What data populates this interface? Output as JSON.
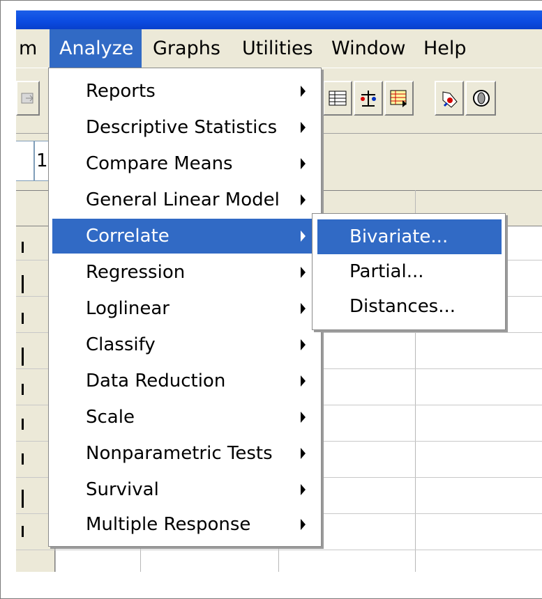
{
  "menubar": {
    "items": [
      {
        "label": "m"
      },
      {
        "label": "Analyze"
      },
      {
        "label": "Graphs"
      },
      {
        "label": "Utilities"
      },
      {
        "label": "Window"
      },
      {
        "label": "Help"
      }
    ]
  },
  "cellbar": {
    "edit_value": "1"
  },
  "analyze_menu": {
    "items": [
      {
        "label": "Reports"
      },
      {
        "label": "Descriptive Statistics"
      },
      {
        "label": "Compare Means"
      },
      {
        "label": "General Linear Model"
      },
      {
        "label": "Correlate"
      },
      {
        "label": "Regression"
      },
      {
        "label": "Loglinear"
      },
      {
        "label": "Classify"
      },
      {
        "label": "Data Reduction"
      },
      {
        "label": "Scale"
      },
      {
        "label": "Nonparametric Tests"
      },
      {
        "label": "Survival"
      },
      {
        "label": "Multiple Response"
      }
    ]
  },
  "correlate_submenu": {
    "items": [
      {
        "label": "Bivariate..."
      },
      {
        "label": "Partial..."
      },
      {
        "label": "Distances..."
      }
    ]
  },
  "colors": {
    "highlight": "#316ac5",
    "titlebar": "#0a4ae0",
    "chrome": "#ece9d8"
  }
}
